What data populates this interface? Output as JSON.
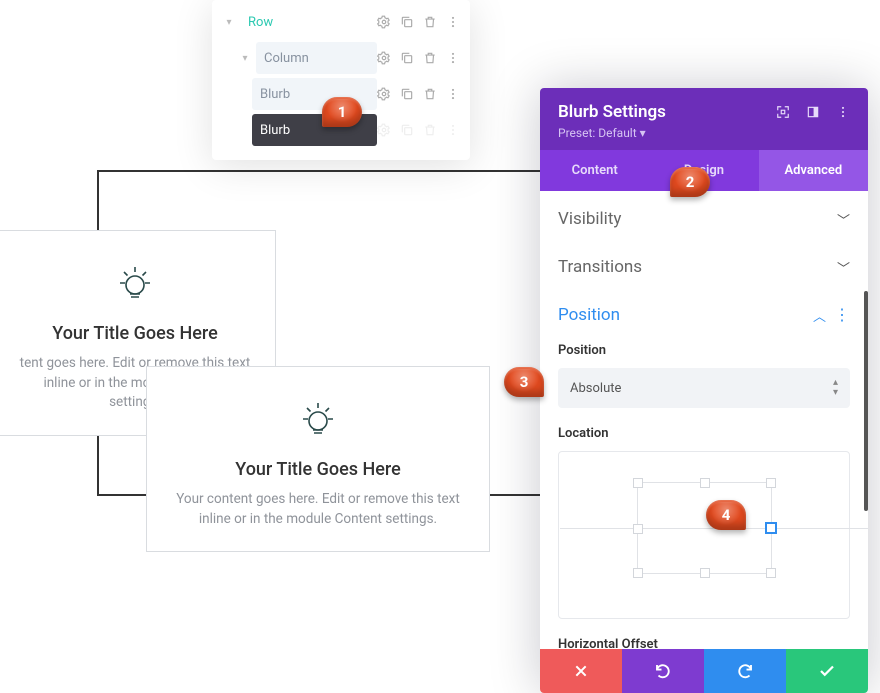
{
  "layers": {
    "row": "Row",
    "column": "Column",
    "blurb": "Blurb",
    "blurb_selected": "Blurb"
  },
  "settings": {
    "title": "Blurb Settings",
    "preset": "Preset: Default",
    "tabs": {
      "content": "Content",
      "design": "Design",
      "advanced": "Advanced"
    },
    "accordion": {
      "visibility": "Visibility",
      "transitions": "Transitions",
      "position": "Position"
    },
    "position": {
      "label": "Position",
      "value": "Absolute",
      "location_label": "Location",
      "hoffset_label": "Horizontal Offset"
    }
  },
  "blurb": {
    "title": "Your Title Goes Here",
    "text_a": "tent goes here. Edit or remove this text inline or in the module Content settings.",
    "text_b": "Your content goes here. Edit or remove this text inline or in the module Content settings."
  },
  "callouts": {
    "c1": "1",
    "c2": "2",
    "c3": "3",
    "c4": "4"
  }
}
